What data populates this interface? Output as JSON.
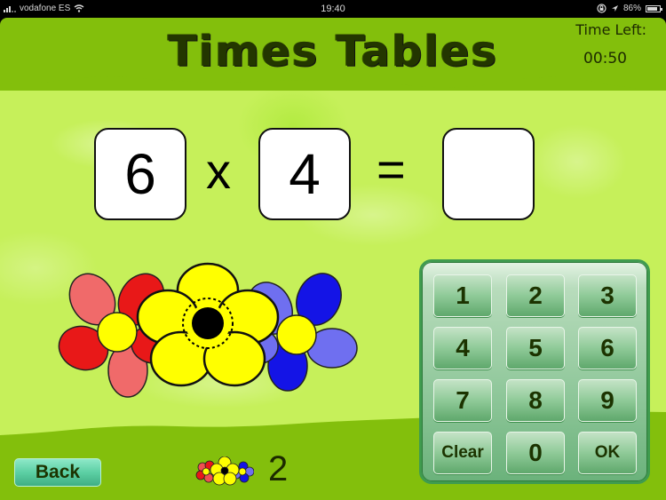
{
  "status_bar": {
    "carrier": "vodafone ES",
    "time": "19:40",
    "battery_percent": "86%",
    "battery_level": 0.86,
    "icons": [
      "signal-icon",
      "wifi-icon",
      "orientation-lock-icon",
      "location-icon",
      "battery-icon"
    ]
  },
  "header": {
    "title": "Times Tables",
    "time_left_label": "Time Left:",
    "time_left_value": "00:50"
  },
  "equation": {
    "operand_a": "6",
    "operator": "x",
    "operand_b": "4",
    "equals": "=",
    "answer": ""
  },
  "keypad": {
    "keys": [
      "1",
      "2",
      "3",
      "4",
      "5",
      "6",
      "7",
      "8",
      "9",
      "Clear",
      "0",
      "OK"
    ]
  },
  "footer": {
    "back_label": "Back",
    "score": "2",
    "score_icon": "flowers-icon"
  },
  "colors": {
    "header_green": "#83bf0c",
    "marble_green": "#c6f05a",
    "keypad_green": "#8fc79a",
    "back_teal": "#5ccfa4",
    "text_dark": "#1c3300"
  }
}
